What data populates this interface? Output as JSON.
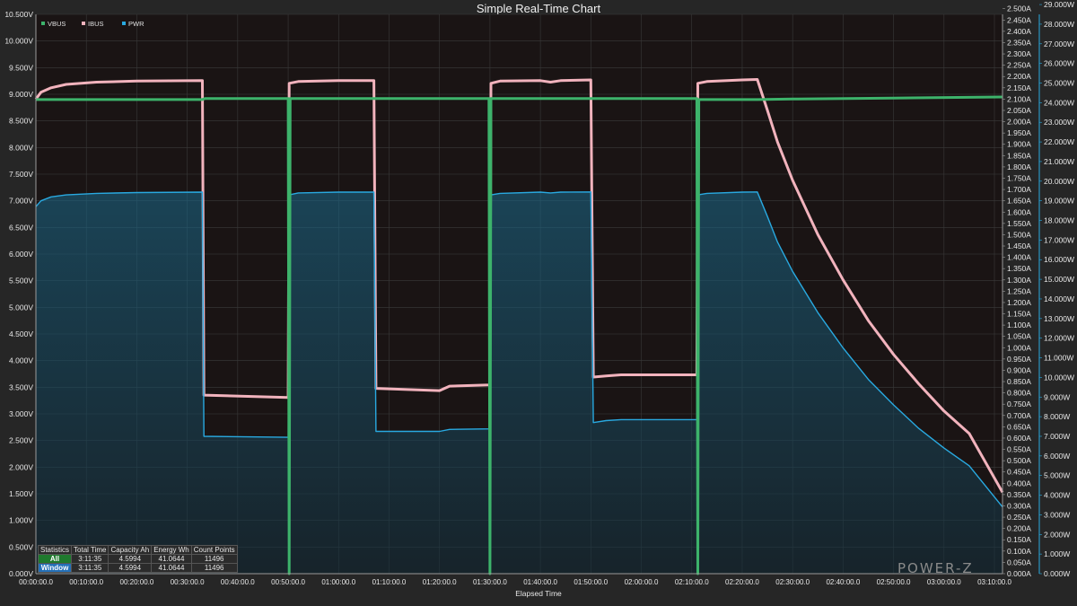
{
  "chart_data": {
    "type": "line",
    "title": "Simple Real-Time Chart",
    "xlabel": "Elapsed Time",
    "x_unit": "minutes",
    "x_ticks": [
      "00:00:00.0",
      "00:10:00.0",
      "00:20:00.0",
      "00:30:00.0",
      "00:40:00.0",
      "00:50:00.0",
      "01:00:00.0",
      "01:10:00.0",
      "01:20:00.0",
      "01:30:00.0",
      "01:40:00.0",
      "01:50:00.0",
      "02:00:00.0",
      "02:10:00.0",
      "02:20:00.0",
      "02:30:00.0",
      "02:40:00.0",
      "02:50:00.0",
      "03:00:00.0",
      "03:10:00.0"
    ],
    "xlim": [
      0,
      191.6
    ],
    "grid": true,
    "legend_position": "top-left",
    "axes": {
      "left": {
        "unit": "V",
        "ylim": [
          0,
          10.5
        ],
        "step": 0.5,
        "decimals": 3
      },
      "right1": {
        "unit": "A",
        "ylim": [
          0,
          2.475
        ],
        "step": 0.05,
        "decimals": 3
      },
      "right2": {
        "unit": "W",
        "ylim": [
          0,
          28.5
        ],
        "step": 1,
        "decimals": 3
      }
    },
    "series": [
      {
        "name": "VBUS",
        "axis": "left",
        "color": "#3db36b",
        "points": [
          [
            0,
            8.9
          ],
          [
            33,
            8.9
          ],
          [
            33.5,
            8.92
          ],
          [
            50,
            8.92
          ],
          [
            50.2,
            0
          ],
          [
            50.4,
            8.92
          ],
          [
            70,
            8.92
          ],
          [
            89.8,
            8.92
          ],
          [
            90,
            0
          ],
          [
            90.2,
            8.92
          ],
          [
            110,
            8.92
          ],
          [
            130,
            8.92
          ],
          [
            131,
            8.92
          ],
          [
            131.2,
            0
          ],
          [
            131.4,
            8.9
          ],
          [
            143,
            8.9
          ],
          [
            150,
            8.91
          ],
          [
            170,
            8.93
          ],
          [
            191.6,
            8.95
          ]
        ]
      },
      {
        "name": "IBUS",
        "axis": "right1",
        "color": "#f2b3bd",
        "points": [
          [
            0,
            2.1
          ],
          [
            1,
            2.13
          ],
          [
            3,
            2.15
          ],
          [
            6,
            2.165
          ],
          [
            12,
            2.175
          ],
          [
            20,
            2.18
          ],
          [
            33,
            2.182
          ],
          [
            33.3,
            0.79
          ],
          [
            50,
            0.78
          ],
          [
            50.2,
            2.17
          ],
          [
            52,
            2.178
          ],
          [
            60,
            2.182
          ],
          [
            67,
            2.182
          ],
          [
            67.4,
            0.82
          ],
          [
            80,
            0.81
          ],
          [
            82,
            0.83
          ],
          [
            90,
            0.835
          ],
          [
            90.2,
            2.17
          ],
          [
            92,
            2.18
          ],
          [
            100,
            2.182
          ],
          [
            102,
            2.175
          ],
          [
            104,
            2.182
          ],
          [
            110,
            2.185
          ],
          [
            110.5,
            0.87
          ],
          [
            113,
            0.875
          ],
          [
            116,
            0.88
          ],
          [
            131,
            0.88
          ],
          [
            131.2,
            2.17
          ],
          [
            133,
            2.178
          ],
          [
            140,
            2.185
          ],
          [
            143,
            2.187
          ],
          [
            145,
            2.05
          ],
          [
            147,
            1.91
          ],
          [
            150,
            1.74
          ],
          [
            155,
            1.5
          ],
          [
            160,
            1.3
          ],
          [
            165,
            1.12
          ],
          [
            170,
            0.97
          ],
          [
            175,
            0.84
          ],
          [
            180,
            0.72
          ],
          [
            185,
            0.62
          ],
          [
            191.6,
            0.36
          ]
        ]
      },
      {
        "name": "PWR",
        "axis": "right2",
        "color": "#29a9e0",
        "area": true,
        "points": [
          [
            0,
            18.7
          ],
          [
            1,
            19.0
          ],
          [
            3,
            19.2
          ],
          [
            6,
            19.3
          ],
          [
            12,
            19.38
          ],
          [
            20,
            19.42
          ],
          [
            33,
            19.44
          ],
          [
            33.3,
            7.0
          ],
          [
            50,
            6.95
          ],
          [
            50.2,
            19.3
          ],
          [
            52,
            19.4
          ],
          [
            60,
            19.44
          ],
          [
            67,
            19.44
          ],
          [
            67.4,
            7.25
          ],
          [
            80,
            7.25
          ],
          [
            82,
            7.35
          ],
          [
            90,
            7.38
          ],
          [
            90.2,
            19.3
          ],
          [
            92,
            19.38
          ],
          [
            100,
            19.44
          ],
          [
            102,
            19.4
          ],
          [
            104,
            19.44
          ],
          [
            110,
            19.45
          ],
          [
            110.5,
            7.7
          ],
          [
            113,
            7.8
          ],
          [
            116,
            7.85
          ],
          [
            131,
            7.85
          ],
          [
            131.2,
            19.3
          ],
          [
            133,
            19.38
          ],
          [
            140,
            19.44
          ],
          [
            143,
            19.45
          ],
          [
            145,
            18.2
          ],
          [
            147,
            16.9
          ],
          [
            150,
            15.4
          ],
          [
            155,
            13.3
          ],
          [
            160,
            11.5
          ],
          [
            165,
            9.9
          ],
          [
            170,
            8.6
          ],
          [
            175,
            7.4
          ],
          [
            180,
            6.4
          ],
          [
            185,
            5.5
          ],
          [
            191.6,
            3.4
          ]
        ]
      }
    ]
  },
  "stats": {
    "headers": [
      "Statistics",
      "Total Time",
      "Capacity Ah",
      "Energy Wh",
      "Count Points"
    ],
    "rows": [
      {
        "label": "All",
        "values": [
          "3:11:35",
          "4.5994",
          "41.0644",
          "11496"
        ]
      },
      {
        "label": "Window",
        "values": [
          "3:11:35",
          "4.5994",
          "41.0644",
          "11496"
        ]
      }
    ]
  },
  "watermark": "POWER-Z",
  "colors": {
    "background": "#262626",
    "plot_bg": "#1a1414",
    "grid": "#3a3a3a"
  }
}
